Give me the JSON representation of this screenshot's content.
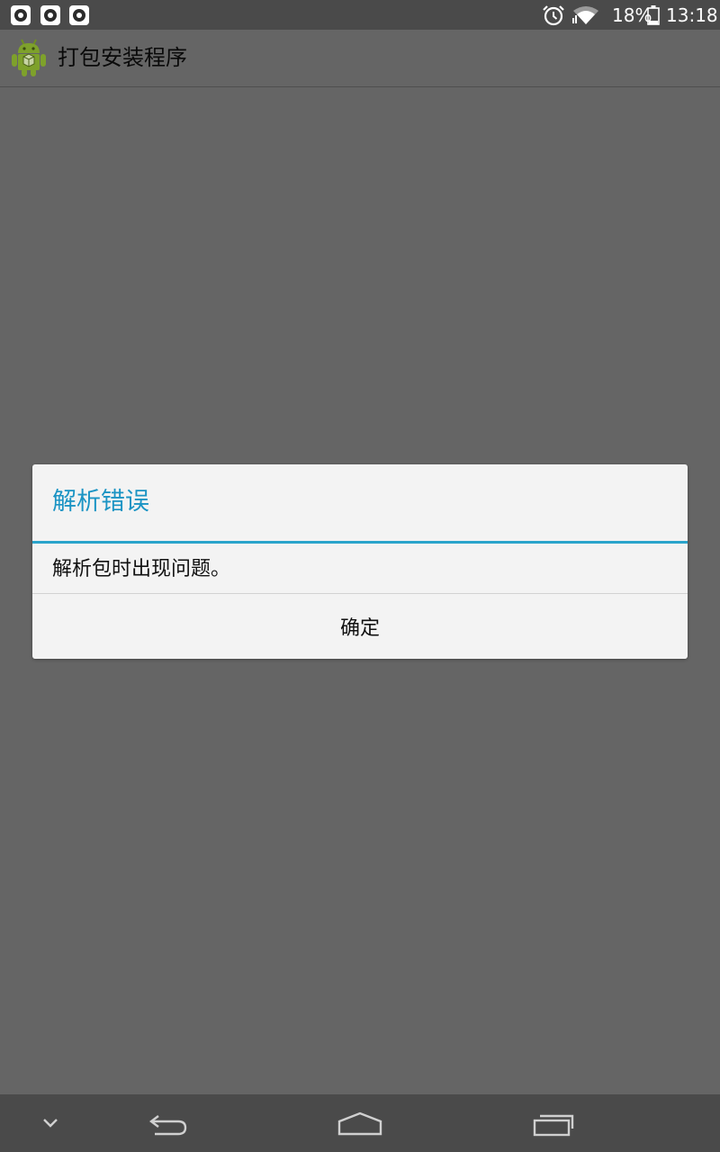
{
  "status_bar": {
    "notification_icons": [
      "notification-icon",
      "notification-icon",
      "notification-icon"
    ],
    "alarm_icon": "alarm-icon",
    "wifi_icon": "wifi-icon",
    "battery_percent": "18%",
    "battery_icon": "battery-icon",
    "time": "13:18"
  },
  "action_bar": {
    "app_icon": "android-icon",
    "title": "打包安装程序"
  },
  "dialog": {
    "title": "解析错误",
    "message": "解析包时出现问题。",
    "ok_label": "确定",
    "accent_color": "#1b94c4"
  },
  "nav_bar": {
    "buttons": [
      "chevron-down-icon",
      "back-icon",
      "home-icon",
      "recent-apps-icon"
    ]
  }
}
